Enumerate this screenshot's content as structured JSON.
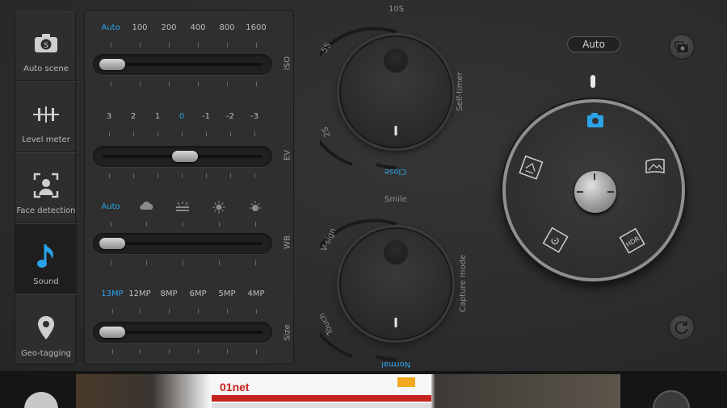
{
  "sidebar": {
    "items": [
      {
        "label": "Auto scene",
        "icon": "camera-scene-icon",
        "active": false
      },
      {
        "label": "Level meter",
        "icon": "level-meter-icon",
        "active": false
      },
      {
        "label": "Face detection",
        "icon": "face-detection-icon",
        "active": false
      },
      {
        "label": "Sound",
        "icon": "music-note-icon",
        "active": true
      },
      {
        "label": "Geo-tagging",
        "icon": "location-pin-icon",
        "active": false
      }
    ]
  },
  "settings": {
    "iso": {
      "label": "ISO",
      "options": [
        "Auto",
        "100",
        "200",
        "400",
        "800",
        "1600"
      ],
      "selected": "Auto"
    },
    "ev": {
      "label": "EV",
      "options": [
        "3",
        "2",
        "1",
        "0",
        "-1",
        "-2",
        "-3"
      ],
      "selected": "0"
    },
    "wb": {
      "label": "WB",
      "options": [
        "Auto"
      ],
      "icons": [
        "cloud-icon",
        "fluorescent-icon",
        "sun-icon",
        "incandescent-icon"
      ],
      "selected": "Auto"
    },
    "size": {
      "label": "Size",
      "options": [
        "13MP",
        "12MP",
        "8MP",
        "6MP",
        "5MP",
        "4MP"
      ],
      "selected": "13MP"
    }
  },
  "self_timer": {
    "label": "Self-timer",
    "options": [
      "10S",
      "5S",
      "2S",
      "Close"
    ],
    "selected": "Close"
  },
  "capture_mode": {
    "label": "Capture mode",
    "options": [
      "Smile",
      "V-sign",
      "Touch",
      "Normal"
    ],
    "selected": "Normal"
  },
  "mode_dial": {
    "auto_label": "Auto",
    "modes": [
      "camera-icon",
      "panorama-icon",
      "hdr-icon",
      "timelapse-icon",
      "portrait-icon"
    ],
    "selected": "camera-icon",
    "hdr_text": "HDR"
  },
  "preview": {
    "site_logo": "01net"
  },
  "colors": {
    "accent": "#2aa3e8",
    "background": "#2b2b2b",
    "panel": "#2f2f2f"
  }
}
